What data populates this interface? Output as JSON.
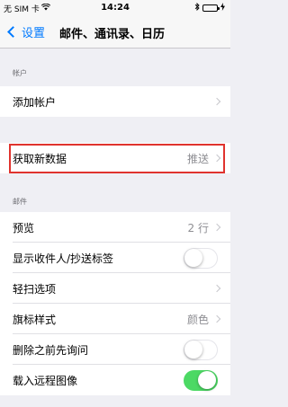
{
  "status_bar": {
    "carrier": "无 SIM 卡",
    "wifi_icon": "wifi-icon",
    "time": "14:24",
    "bluetooth_icon": "bluetooth-icon",
    "battery_icon": "battery-icon",
    "charging_icon": "charging-icon"
  },
  "nav": {
    "back_label": "设置",
    "title": "邮件、通讯录、日历"
  },
  "sections": {
    "accounts_header": "帐户",
    "mail_header": "邮件"
  },
  "rows": {
    "add_account": {
      "label": "添加帐户"
    },
    "fetch_new_data": {
      "label": "获取新数据",
      "value": "推送"
    },
    "preview": {
      "label": "预览",
      "value": "2 行"
    },
    "show_to_cc": {
      "label": "显示收件人/抄送标签",
      "on": false
    },
    "swipe_options": {
      "label": "轻扫选项"
    },
    "flag_style": {
      "label": "旗标样式",
      "value": "颜色"
    },
    "ask_before_deleting": {
      "label": "删除之前先询问",
      "on": false
    },
    "load_remote_images": {
      "label": "载入远程图像",
      "on": true
    }
  },
  "colors": {
    "accent": "#007aff",
    "toggle_on": "#4cd964",
    "highlight_box": "#e0332e"
  }
}
